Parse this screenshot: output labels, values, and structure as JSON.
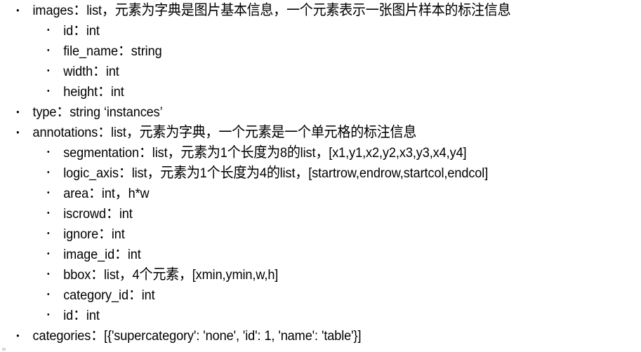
{
  "document": {
    "background_color": "#ffffff",
    "text_color": "#000000",
    "bullet_glyph": "•",
    "lines": [
      {
        "level": 1,
        "text": "images：list，元素为字典是图片基本信息，一个元素表示一张图片样本的标注信息"
      },
      {
        "level": 2,
        "text": "id：int"
      },
      {
        "level": 2,
        "text": "file_name：string"
      },
      {
        "level": 2,
        "text": "width：int"
      },
      {
        "level": 2,
        "text": "height：int"
      },
      {
        "level": 1,
        "text": "type：string  ‘instances’"
      },
      {
        "level": 1,
        "text": "annotations：list，元素为字典，一个元素是一个单元格的标注信息"
      },
      {
        "level": 2,
        "text": "segmentation：list，元素为1个长度为8的list，[x1,y1,x2,y2,x3,y3,x4,y4]"
      },
      {
        "level": 2,
        "text": "logic_axis：list，元素为1个长度为4的list，[startrow,endrow,startcol,endcol]"
      },
      {
        "level": 2,
        "text": "area：int，h*w"
      },
      {
        "level": 2,
        "text": "iscrowd：int"
      },
      {
        "level": 2,
        "text": "ignore：int"
      },
      {
        "level": 2,
        "text": "image_id：int"
      },
      {
        "level": 2,
        "text": "bbox：list，4个元素，[xmin,ymin,w,h]"
      },
      {
        "level": 2,
        "text": "category_id：int"
      },
      {
        "level": 2,
        "text": "id：int"
      },
      {
        "level": 1,
        "text": "categories：[{'supercategory': 'none', 'id': 1, 'name': 'table'}]"
      }
    ]
  }
}
